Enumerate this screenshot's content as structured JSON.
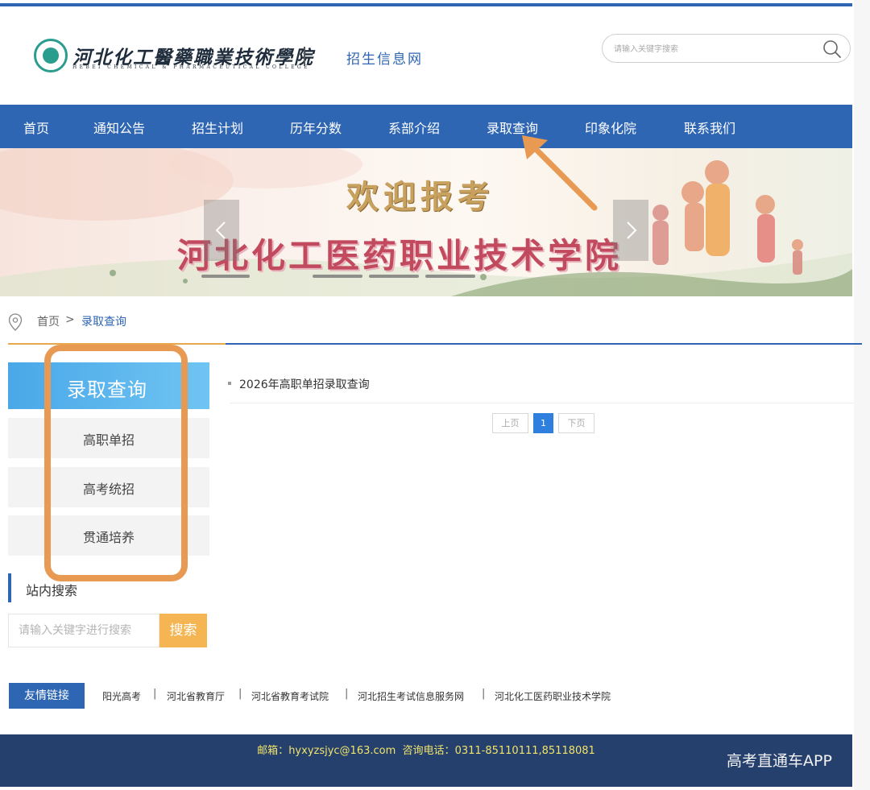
{
  "header": {
    "logo_cn": "河北化工醫藥職業技術學院",
    "logo_en": "HEBEI CHEMICAL & PHARMACEUTICAL COLLEGE",
    "site_subtitle": "招生信息网",
    "search_placeholder": "请输入关键字搜索"
  },
  "nav": {
    "items": [
      "首页",
      "通知公告",
      "招生计划",
      "历年分数",
      "系部介绍",
      "录取查询",
      "印象化院",
      "联系我们"
    ]
  },
  "banner": {
    "title": "欢迎报考",
    "subtitle": "河北化工医药职业技术学院"
  },
  "breadcrumb": {
    "home": "首页",
    "separator": ">",
    "current": "录取查询"
  },
  "sidebar": {
    "heading": "录取查询",
    "items": [
      "高职单招",
      "高考统招",
      "贯通培养"
    ],
    "site_search_title": "站内搜索",
    "search_placeholder": "请输入关键字进行搜索",
    "search_button": "搜索"
  },
  "content": {
    "list": [
      "2026年高职单招录取查询"
    ],
    "pagination": {
      "prev": "上页",
      "current": "1",
      "next": "下页"
    }
  },
  "friendly_links": {
    "label": "友情链接",
    "items": [
      "阳光高考",
      "河北省教育厅",
      "河北省教育考试院",
      "河北招生考试信息服务网",
      "河北化工医药职业技术学院"
    ],
    "separator": "|"
  },
  "footer": {
    "email_label": "邮箱：",
    "email": "hyxyzsjyc@163.com",
    "phone_label": "咨询电话：",
    "phone": "0311-85110111,85118081"
  },
  "watermark": "高考直通车APP",
  "colors": {
    "nav_blue": "#2e66b3",
    "accent_orange": "#e99a52",
    "search_button": "#f4b552",
    "footer_bg": "#26406e",
    "footer_text": "#f0e36a"
  }
}
